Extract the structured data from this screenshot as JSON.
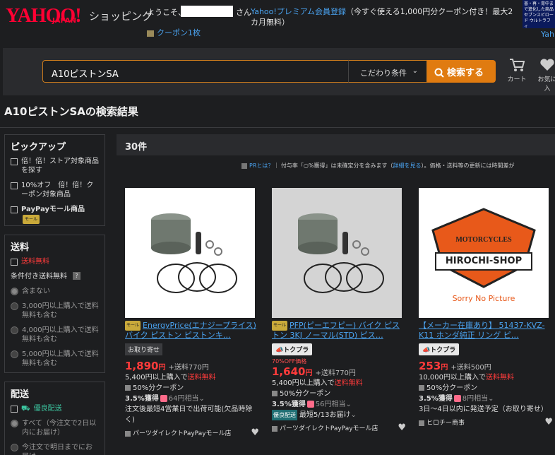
{
  "header": {
    "logo": "YAHOO!",
    "logo_sub": "JAPAN",
    "logo_shop": "ショッピング",
    "welcome": "ようこそ、",
    "san": "さん",
    "premium_link": "Yahoo!プレミアム会員登録",
    "premium_text": "（今すぐ使える1,000円分クーポン付き！最大2カ月無料）",
    "coupon": "クーポン1枚",
    "ad_text": "普・再・育中まで進化した商品 セブンスビロード ウルトラフィ",
    "ad_link": "Yah"
  },
  "search": {
    "value": "A10ピストンSA",
    "condition_label": "こだわり条件",
    "button_label": "検索する",
    "cart_label": "カート",
    "fav_label": "お気に入"
  },
  "result_title": "A10ピストンSAの検索結果",
  "sidebar": {
    "pickup": {
      "title": "ピックアップ",
      "items": [
        "倍！倍！ストア対象商品を探す",
        "10%オフ　倍！倍！クーポン対象商品",
        "PayPayモール商品"
      ],
      "mall_tag": "モール"
    },
    "shipping": {
      "title": "送料",
      "free": "送料無料",
      "conditional_title": "条件付き送料無料",
      "help": "?",
      "options": [
        "含まない",
        "3,000円以上購入で送料無料も含む",
        "4,000円以上購入で送料無料も含む",
        "5,000円以上購入で送料無料も含む"
      ]
    },
    "delivery": {
      "title": "配送",
      "good": "優良配送",
      "options": [
        "すべて（今注文で2日以内にお届け）",
        "今注文で明日までにお届け"
      ]
    }
  },
  "main": {
    "count": "30件",
    "notice_pr": "PRとは？",
    "notice_text": "｜ 付与率「○%獲得」は未確定分を含みます（",
    "notice_link": "詳細を見る",
    "notice_tail": "）。価格・送料等の更新には時間差が"
  },
  "products": [
    {
      "title": "EnergyPrice(エナジープライス) バイク ピストン ピストンキ…",
      "mall": "モール",
      "badge": "お取り寄せ",
      "off": "",
      "price": "1,890",
      "yen": "円",
      "shipping": "+送料770円",
      "free_cond": "5,400円以上購入で",
      "free_label": "送料無料",
      "coupon": "50%分クーポン",
      "points": "3.5%獲得",
      "points_value": "64円相当",
      "delivery": "注文後最短4営業日で出荷可能(欠品時除く)",
      "seller": "パーツダイレクトPayPayモール店"
    },
    {
      "title": "PFP(ピーエフピー) バイク ピストン 3KJ ノーマル(STD) ピス…",
      "mall": "モール",
      "badge": "トクプラ",
      "off": "70%OFF価格",
      "price": "1,640",
      "yen": "円",
      "shipping": "+送料770円",
      "free_cond": "5,400円以上購入で",
      "free_label": "送料無料",
      "coupon": "50%分クーポン",
      "points": "3.5%獲得",
      "points_value": "56円相当",
      "good_delivery": "優良配送",
      "delivery": "最短5/13お届け",
      "seller": "パーツダイレクトPayPayモール店"
    },
    {
      "title": "【メーカー在庫あり】 51437-KVZ-K11 ホンダ純正 リング ピ…",
      "mall": "",
      "badge": "トクプラ",
      "off": "",
      "price": "253",
      "yen": "円",
      "shipping": "+送料500円",
      "free_cond": "10,000円以上購入で",
      "free_label": "送料無料",
      "coupon": "50%分クーポン",
      "points": "3.5%獲得",
      "points_value": "8円相当",
      "delivery": "3日〜4日以内に発送予定（お取り寄せ）",
      "seller": "ヒロチー商事",
      "logo_top": "MOTORCYCLES",
      "logo_main": "HIROCHI-SHOP",
      "logo_sorry": "Sorry No Picture"
    }
  ],
  "colors": {
    "accent": "#e07b10",
    "price": "#ff3b3b",
    "link": "#4aa3f0",
    "logo": "#ff0033"
  }
}
